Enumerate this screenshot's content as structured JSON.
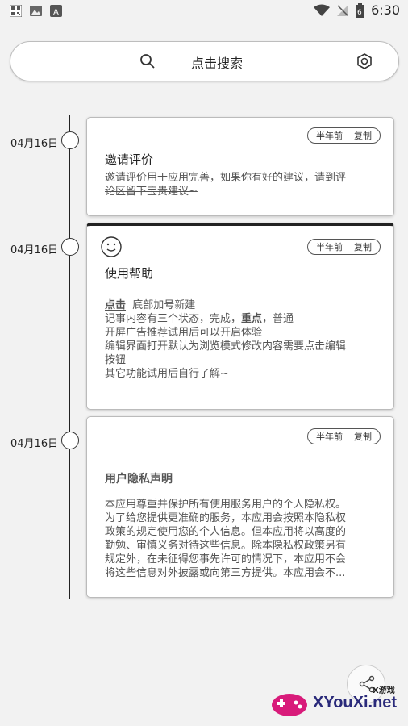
{
  "status_bar": {
    "time": "6:30",
    "battery_level": "6"
  },
  "search": {
    "label": "点击搜索"
  },
  "timeline": [
    {
      "date": "04月16日",
      "meta_time": "半年前",
      "meta_action": "复制",
      "title": "邀请评价",
      "body_line1": "邀请评价用于应用完善，如果你有好的建议，请到评",
      "body_line2": "论区留下宝贵建议~"
    },
    {
      "date": "04月16日",
      "meta_time": "半年前",
      "meta_action": "复制",
      "title": "使用帮助",
      "line1_emph": "点击",
      "line1_rest": "底部加号新建",
      "line2_a": "记事内容有三个状态，完成，",
      "line2_bold": "重点",
      "line2_b": "，普通",
      "line3": "开屏广告推荐试用后可以开启体验",
      "line4": "编辑界面打开默认为浏览模式修改内容需要点击编辑",
      "line5": "按钮",
      "line6": "其它功能试用后自行了解~"
    },
    {
      "date": "04月16日",
      "meta_time": "半年前",
      "meta_action": "复制",
      "title": "用户隐私声明",
      "body_lines": [
        "本应用尊重并保护所有使用服务用户的个人隐私权。",
        "为了给您提供更准确的服务，本应用会按照本隐私权",
        "政策的规定使用您的个人信息。但本应用将以高度的",
        "勤勉、审慎义务对待这些信息。除本隐私权政策另有",
        "规定外，在未征得您事先许可的情况下，本应用不会",
        "将这些信息对外披露或向第三方提供。本应用会不..."
      ]
    }
  ],
  "watermark": {
    "brand": "XYouXi.net",
    "small": "X游戏"
  }
}
